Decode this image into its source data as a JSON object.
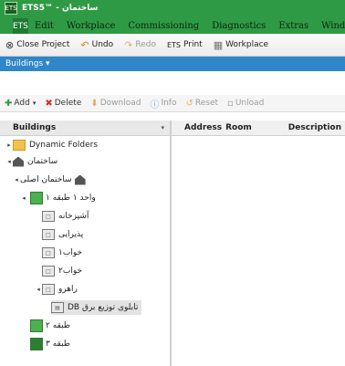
{
  "window": {
    "title": "ETS5™ - ساختمان",
    "app_badge": "ETS"
  },
  "menubar": {
    "ets_label": "ETS",
    "items": [
      "Edit",
      "Workplace",
      "Commissioning",
      "Diagnostics",
      "Extras",
      "Window"
    ]
  },
  "toolbar": {
    "items": [
      {
        "label": "Close Project",
        "icon": "close-project-icon"
      },
      {
        "label": "Undo",
        "icon": "undo-icon"
      },
      {
        "label": "Redo",
        "icon": "redo-icon"
      },
      {
        "label": "Print",
        "icon": "print-icon"
      },
      {
        "label": "Workplace",
        "icon": "workplace-icon"
      }
    ]
  },
  "panel": {
    "title": "Buildings ▾"
  },
  "secondary_toolbar": {
    "add": "Add",
    "delete": "Delete",
    "download": "Download",
    "info": "Info",
    "reset": "Reset",
    "unload": "Unload"
  },
  "tree_header": {
    "title": "Buildings"
  },
  "grid_header": {
    "columns": [
      "Address",
      "Room",
      "Description"
    ]
  },
  "tree": {
    "dynamic_folders": "Dynamic Folders",
    "root": "ساختمان",
    "building": "ساختمان اصلی",
    "floor1": "واحد ۱ طبقه ۱",
    "rooms": [
      "آشپزخانه",
      "پذیرایی",
      "خواب۱",
      "خواب۲",
      "راهرو"
    ],
    "distribution": "تابلوی توزیع برق DB",
    "floor2": "طبقه ۲",
    "floor3": "طبقه ۳"
  }
}
